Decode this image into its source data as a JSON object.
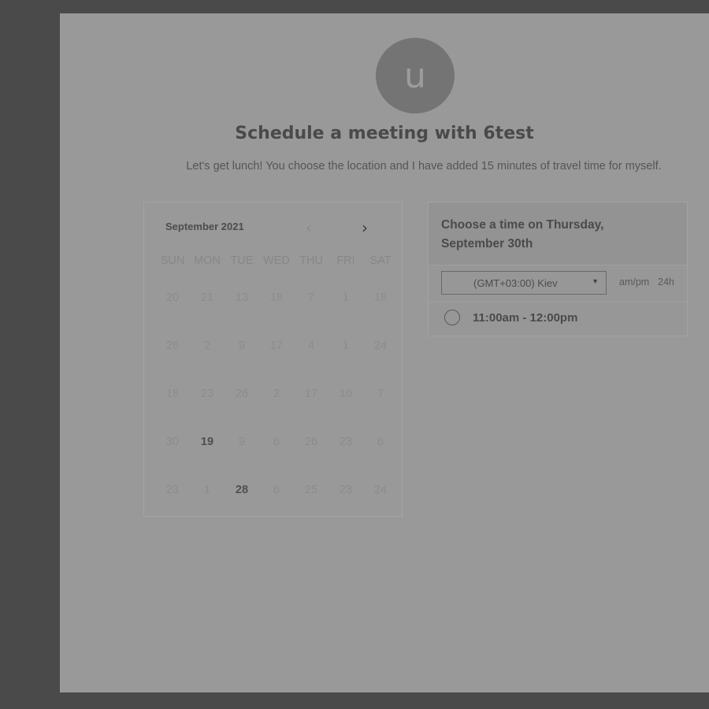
{
  "header": {
    "avatar_letter": "u",
    "title": "Schedule a meeting with 6test",
    "subtitle": "Let's get lunch! You choose the location and I have added 15 minutes of travel time for myself."
  },
  "calendar": {
    "month_label": "September 2021",
    "prev_icon": "chevron-left-icon",
    "next_icon": "chevron-right-icon",
    "prev_glyph": "‹",
    "next_glyph": "›",
    "weekdays": [
      "SUN",
      "MON",
      "TUE",
      "WED",
      "THU",
      "FRI",
      "SAT"
    ],
    "weeks": [
      [
        "20",
        "21",
        "13",
        "18",
        "7",
        "1",
        "18"
      ],
      [
        "26",
        "2",
        "9",
        "17",
        "4",
        "1",
        "24"
      ],
      [
        "18",
        "23",
        "26",
        "2",
        "17",
        "10",
        "7"
      ],
      [
        "30",
        "19",
        "9",
        "6",
        "26",
        "23",
        "6"
      ],
      [
        "23",
        "1",
        "28",
        "6",
        "25",
        "23",
        "24"
      ]
    ]
  },
  "time_panel": {
    "title": "Choose a time on Thursday, September 30th",
    "timezone": "(GMT+03:00) Kiev",
    "format_ampm": "am/pm",
    "format_24h": "24h",
    "slots": [
      "11:00am - 12:00pm"
    ]
  },
  "colors": {
    "overlay": "#4a4a4a",
    "page": "#999999",
    "avatar": "#747474"
  }
}
